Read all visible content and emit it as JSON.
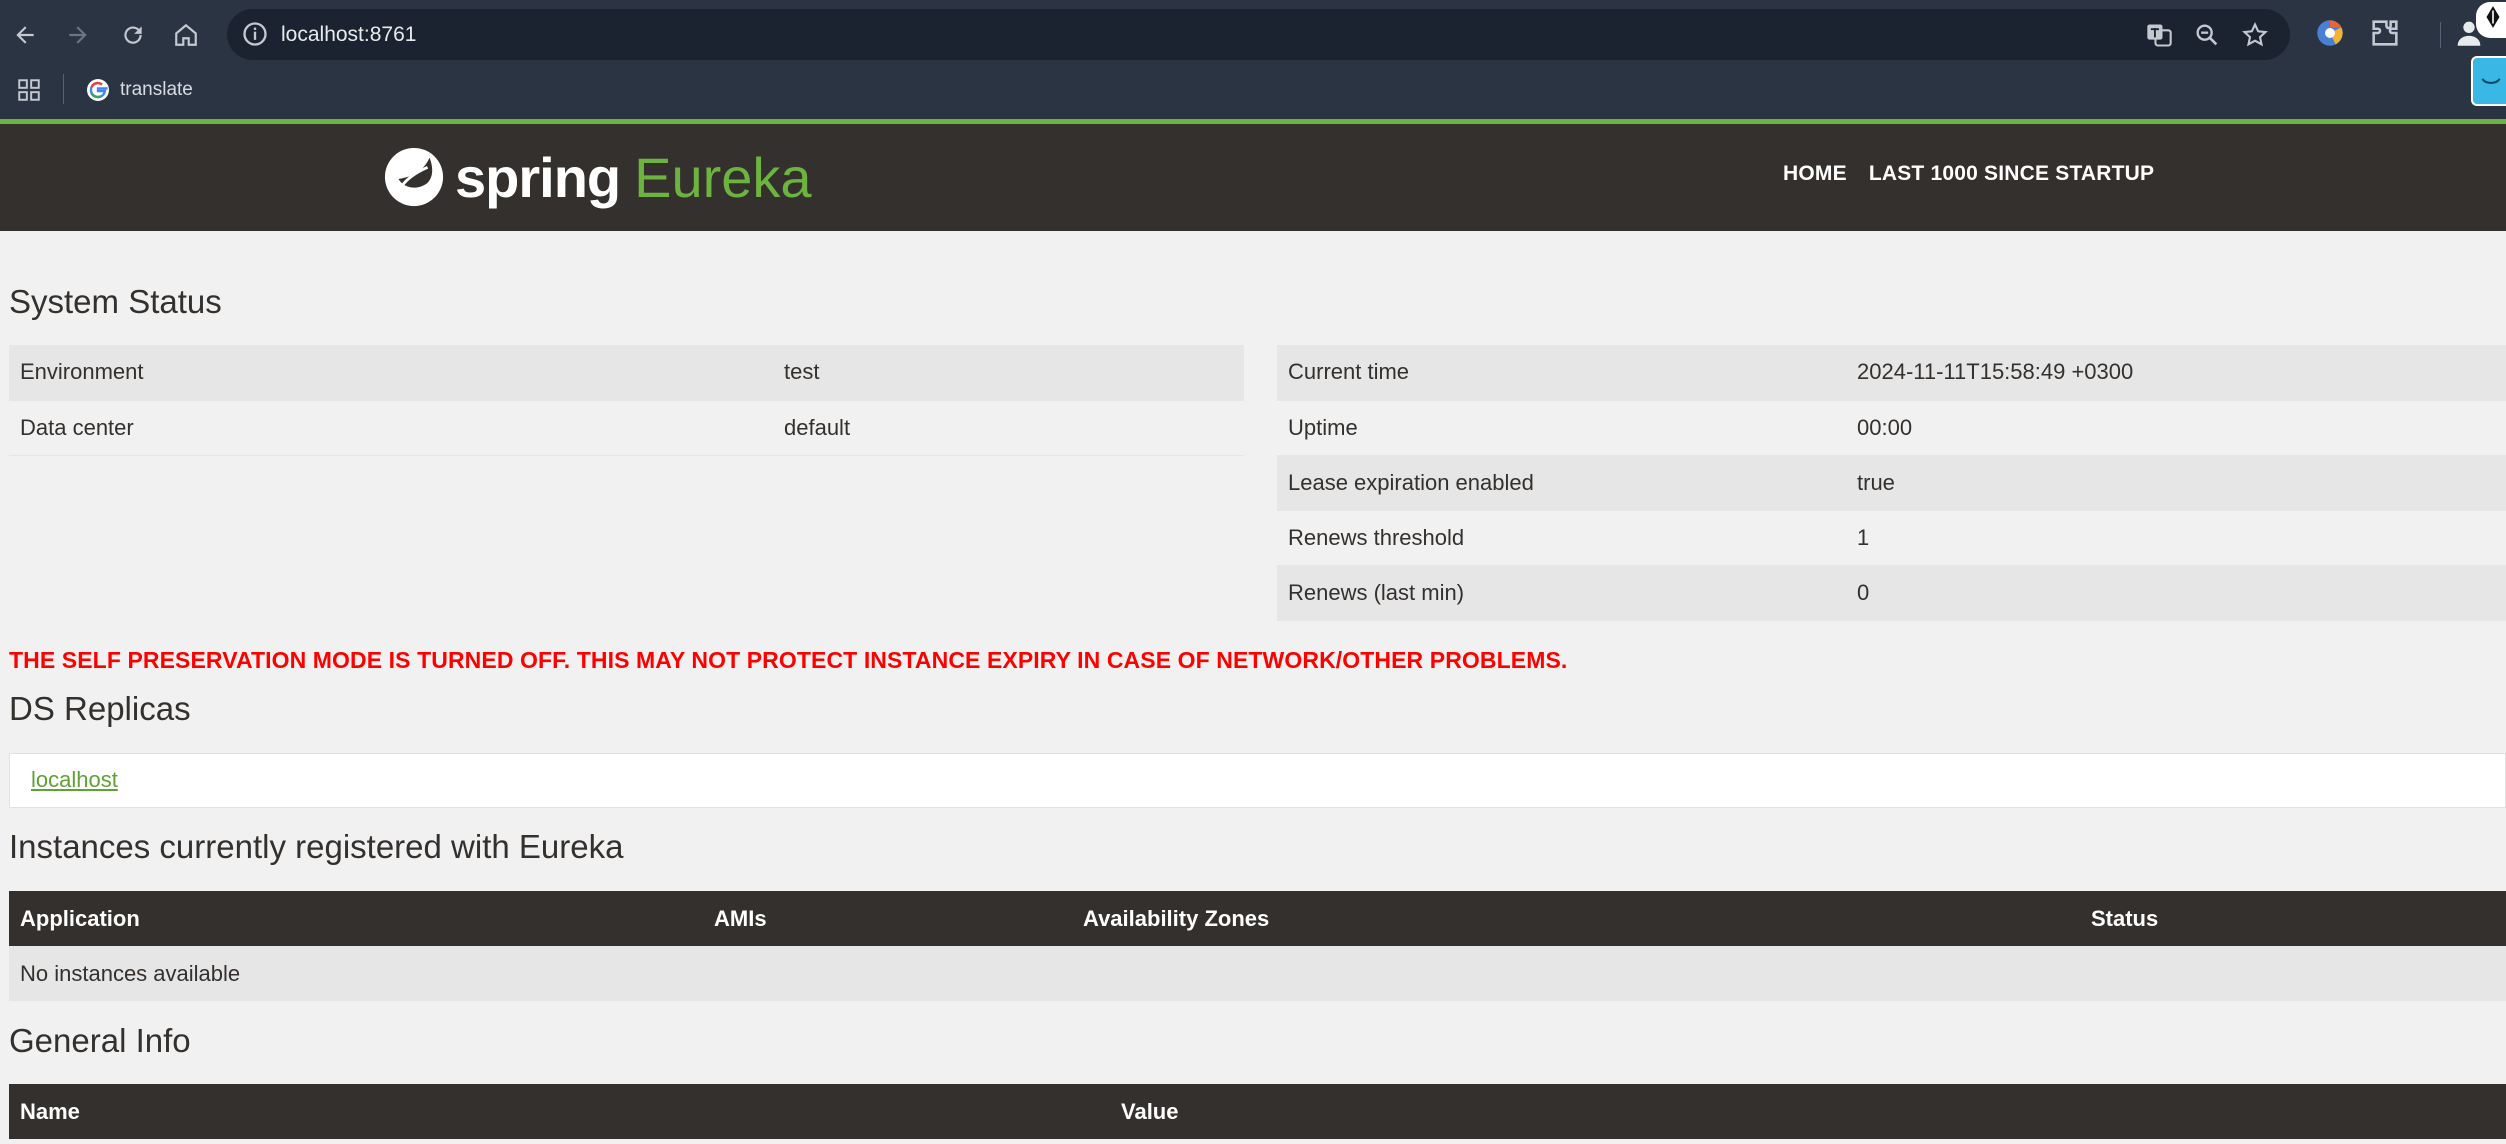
{
  "browser": {
    "url": "localhost:8761",
    "bookmarks": [
      {
        "label": "translate"
      }
    ],
    "icons": {
      "back": "back-arrow-icon",
      "forward": "forward-arrow-icon",
      "reload": "reload-icon",
      "home": "home-icon",
      "site_info": "site-info-icon",
      "translate": "translate-icon",
      "zoom": "zoom-icon",
      "bookmark": "star-icon",
      "extensions": "puzzle-icon",
      "apps": "apps-grid-icon",
      "profile": "profile-icon"
    }
  },
  "colors": {
    "chrome_bg": "#2a3442",
    "spring_green": "#6db33f",
    "navbar_bg": "#34302d",
    "warning": "#ff0000"
  },
  "navbar": {
    "brand_spring": "spring",
    "brand_eureka": "Eureka",
    "links": [
      {
        "label": "HOME"
      },
      {
        "label": "LAST 1000 SINCE STARTUP"
      }
    ]
  },
  "system_status": {
    "title": "System Status",
    "left": [
      {
        "key": "Environment",
        "value": "test"
      },
      {
        "key": "Data center",
        "value": "default"
      }
    ],
    "right": [
      {
        "key": "Current time",
        "value": "2024-11-11T15:58:49 +0300"
      },
      {
        "key": "Uptime",
        "value": "00:00"
      },
      {
        "key": "Lease expiration enabled",
        "value": "true"
      },
      {
        "key": "Renews threshold",
        "value": "1"
      },
      {
        "key": "Renews (last min)",
        "value": "0"
      }
    ]
  },
  "warning": "THE SELF PRESERVATION MODE IS TURNED OFF. THIS MAY NOT PROTECT INSTANCE EXPIRY IN CASE OF NETWORK/OTHER PROBLEMS.",
  "ds_replicas": {
    "title": "DS Replicas",
    "link": "localhost"
  },
  "instances": {
    "title": "Instances currently registered with Eureka",
    "columns": [
      "Application",
      "AMIs",
      "Availability Zones",
      "Status"
    ],
    "empty_text": "No instances available"
  },
  "general_info": {
    "title": "General Info",
    "columns": [
      "Name",
      "Value"
    ]
  }
}
